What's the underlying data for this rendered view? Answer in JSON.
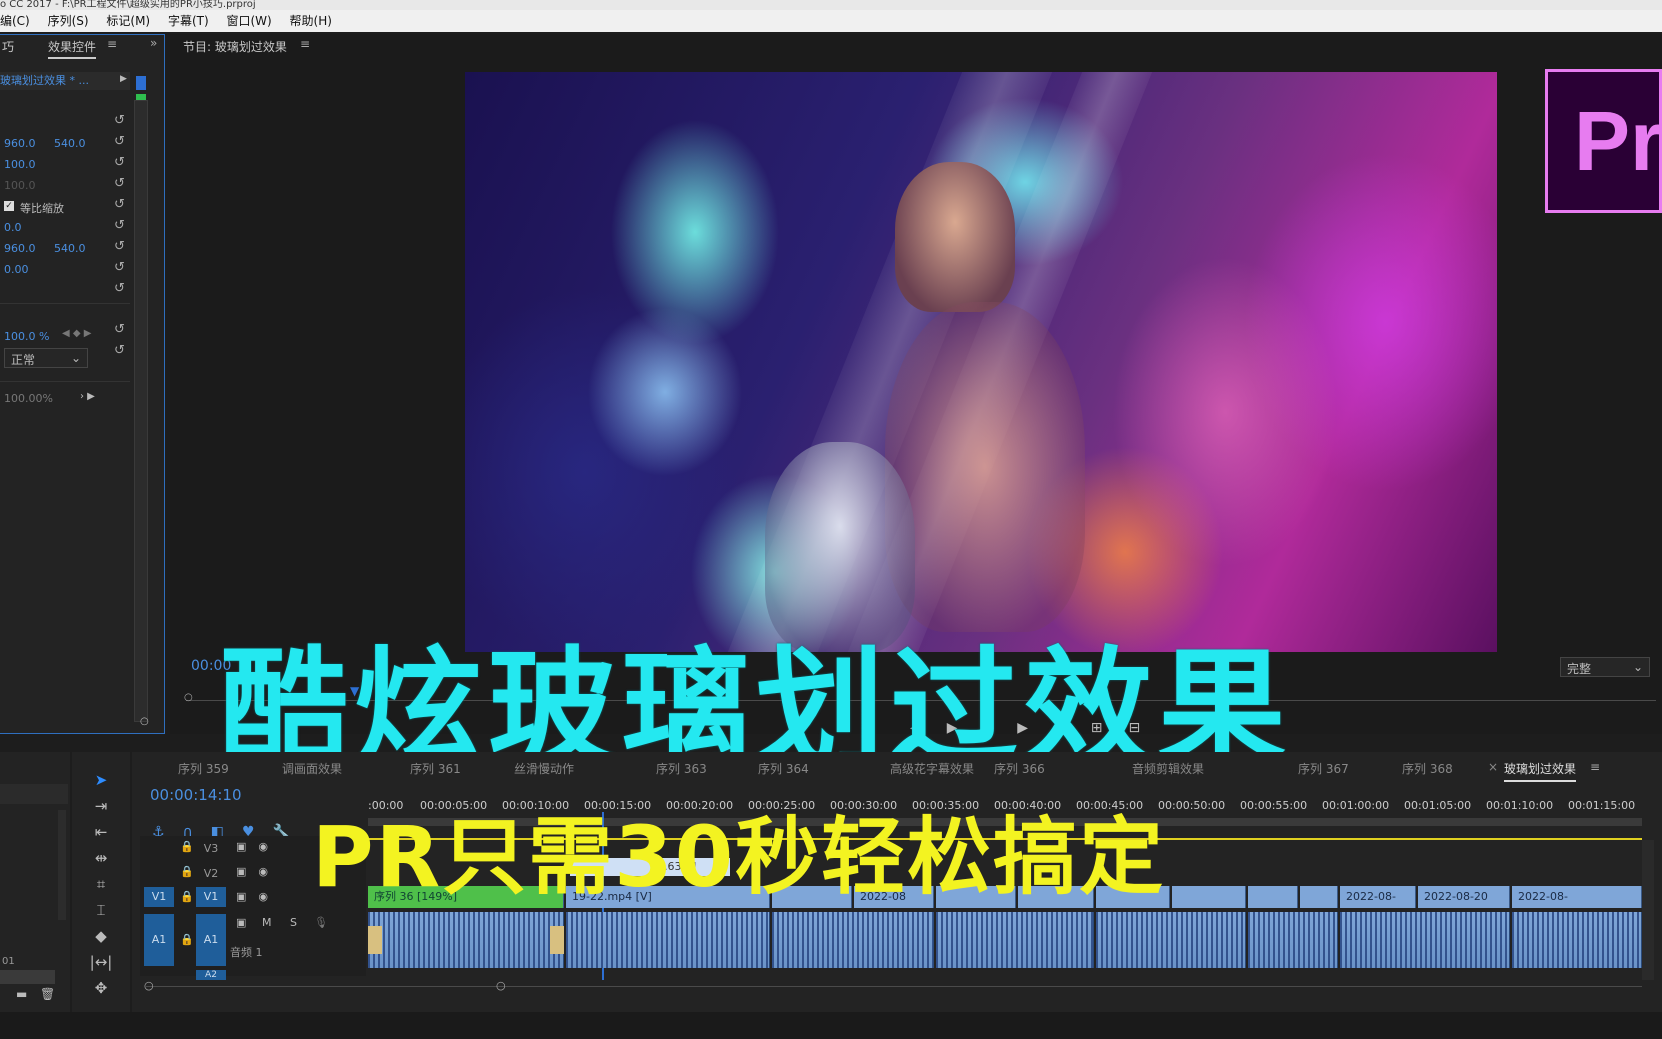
{
  "window": {
    "title": "o CC 2017 - F:\\PR工程文件\\超级实用的PR小技巧.prproj"
  },
  "menu": [
    "编(C)",
    "序列(S)",
    "标记(M)",
    "字幕(T)",
    "窗口(W)",
    "帮助(H)"
  ],
  "effect_controls": {
    "tab_left": "巧",
    "tab": "效果控件",
    "clip_label": "玻璃划过效果 * ...",
    "rows": [
      {
        "v1": "960.0",
        "v2": "540.0"
      },
      {
        "v1": "100.0",
        "v2": ""
      },
      {
        "v1": "100.0",
        "v2": ""
      },
      {
        "v1": "等比缩放",
        "v2": ""
      },
      {
        "v1": "0.0",
        "v2": ""
      },
      {
        "v1": "960.0",
        "v2": "540.0"
      },
      {
        "v1": "0.00",
        "v2": ""
      }
    ],
    "opacity": "100.0 %",
    "blend_mode": "正常",
    "speed": "100.00%"
  },
  "program_monitor": {
    "title": "节目: 玻璃划过效果",
    "timecode": "00:00",
    "quality": "完整",
    "logo_text": "Pr"
  },
  "overlay": {
    "headline": "酷炫玻璃划过效果",
    "subline": "PR只需30秒轻松搞定"
  },
  "timeline": {
    "tabs": [
      "序列 359",
      "调画面效果",
      "序列 361",
      "丝滑慢动作",
      "序列 363",
      "序列 364",
      "高级花字幕效果",
      "序列 366",
      "音频剪辑效果",
      "序列 367",
      "序列 368",
      "玻璃划过效果"
    ],
    "timecode": "00:00:14:10",
    "ruler": [
      ":00:00",
      "00:00:05:00",
      "00:00:10:00",
      "00:00:15:00",
      "00:00:20:00",
      "00:00:25:00",
      "00:00:30:00",
      "00:00:35:00",
      "00:00:40:00",
      "00:00:45:00",
      "00:00:50:00",
      "00:00:55:00",
      "00:01:00:00",
      "00:01:05:00",
      "00:01:10:00",
      "00:01:15:00"
    ],
    "tracks": {
      "v3": "V3",
      "v2": "V2",
      "v1": "V1",
      "a1": "A1",
      "a2": "A2",
      "audio_name": "音频 1",
      "m": "M",
      "s": "S"
    },
    "clip_labels": {
      "first": "序列 36 [149%]",
      "percent": "89.63%]",
      "c1": "2022-08",
      "c2": "2022-08-",
      "c3": "2022-08-20",
      "c4": "2022-08-",
      "v_tag": "19-22.mp4 [V]"
    },
    "project_label": "01"
  }
}
